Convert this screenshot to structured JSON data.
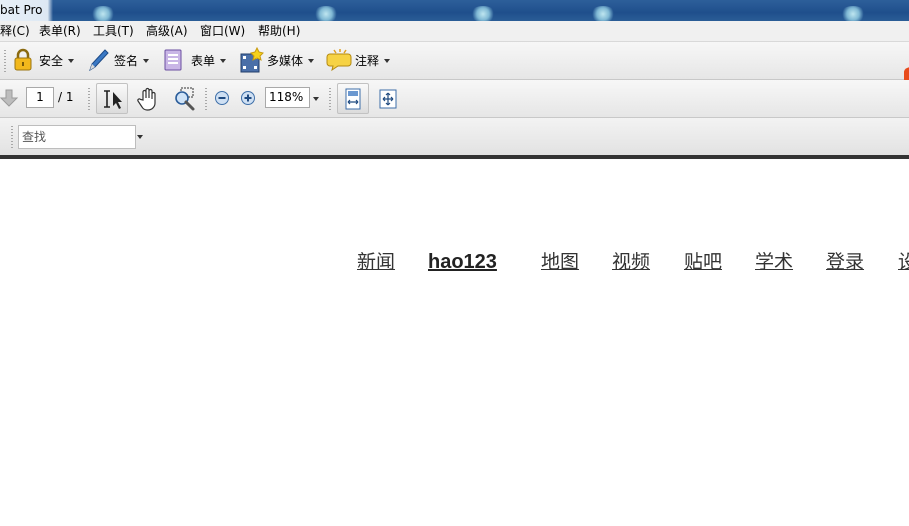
{
  "window": {
    "title": "bat Pro"
  },
  "menu": [
    "释(C)",
    "表单(R)",
    "工具(T)",
    "高级(A)",
    "窗口(W)",
    "帮助(H)"
  ],
  "toolbar1": {
    "security_label": "安全",
    "sign_label": "签名",
    "forms_label": "表单",
    "multimedia_label": "多媒体",
    "comment_label": "注释"
  },
  "toolbar2": {
    "page_current": "1",
    "page_total": "/ 1",
    "zoom": "118%"
  },
  "toolbar3": {
    "find_placeholder": "查找"
  },
  "page": {
    "links": [
      "新闻",
      "hao123",
      "地图",
      "视频",
      "贴吧",
      "学术",
      "登录",
      "设"
    ]
  },
  "colors": {
    "titlebar": "#1f4f8c",
    "toolbar": "#ececec",
    "link_text": "#333333"
  }
}
